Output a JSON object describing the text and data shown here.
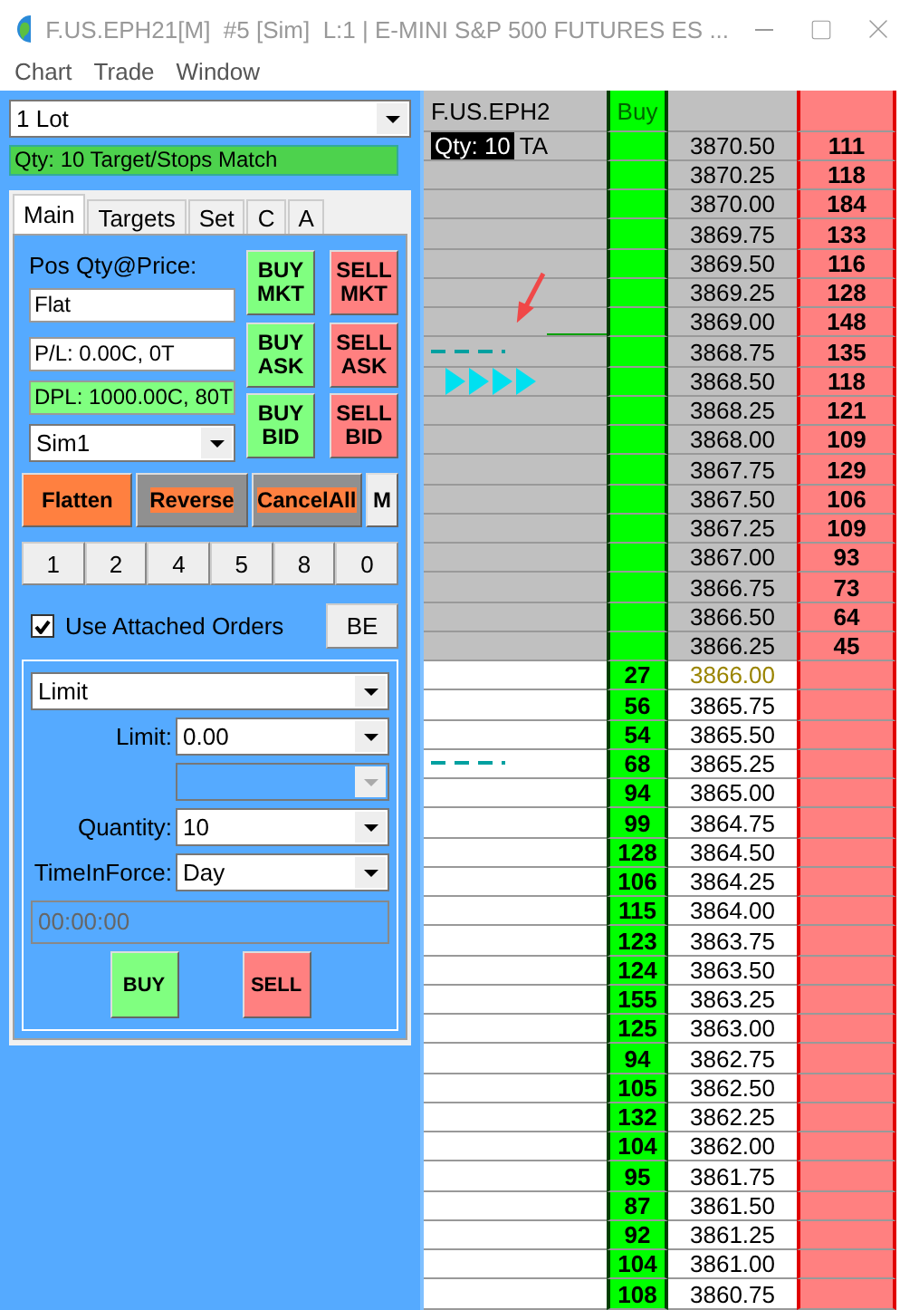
{
  "window": {
    "title": "F.US.EPH21[M]  #5 [Sim]  L:1 | E-MINI S&P 500 FUTURES ES ..."
  },
  "menu": [
    "Chart",
    "Trade",
    "Window"
  ],
  "lot_select": {
    "value": "1 Lot"
  },
  "status_banner": "Qty: 10 Target/Stops Match",
  "tabs": [
    {
      "label": "Main",
      "selected": true
    },
    {
      "label": "Targets",
      "selected": false
    },
    {
      "label": "Set",
      "selected": false
    },
    {
      "label": "C",
      "selected": false
    },
    {
      "label": "A",
      "selected": false
    }
  ],
  "position": {
    "label": "Pos Qty@Price:",
    "value": "Flat"
  },
  "pl_field": {
    "value": "P/L: 0.00C, 0T"
  },
  "dpl_field": {
    "value": "DPL: 1000.00C, 80T"
  },
  "account_select": {
    "value": "Sim1"
  },
  "quick_buttons": [
    {
      "label": "BUY MKT",
      "kind": "buy"
    },
    {
      "label": "SELL MKT",
      "kind": "sell"
    },
    {
      "label": "BUY ASK",
      "kind": "buy"
    },
    {
      "label": "SELL ASK",
      "kind": "sell"
    },
    {
      "label": "BUY BID",
      "kind": "buy"
    },
    {
      "label": "SELL BID",
      "kind": "sell"
    }
  ],
  "action_buttons": [
    {
      "label": "Flatten",
      "kind": "flatten"
    },
    {
      "label": "Reverse",
      "kind": "reverse"
    },
    {
      "label": "CancelAll",
      "kind": "cancel"
    },
    {
      "label": "M",
      "kind": "plain"
    }
  ],
  "qty_presets": [
    "1",
    "2",
    "4",
    "5",
    "8",
    "0"
  ],
  "use_attached_orders": {
    "label": "Use Attached Orders",
    "checked": true
  },
  "be_button": "BE",
  "order": {
    "type": "Limit",
    "fields": [
      {
        "label": "Limit:",
        "value": "0.00",
        "disabled": false
      },
      {
        "disabled": true
      },
      {
        "label": "Quantity:",
        "value": "10",
        "disabled": false
      },
      {
        "label": "TimeInForce:",
        "value": "Day",
        "disabled": false
      }
    ],
    "time_value": "00:00:00",
    "buy_label": "BUY",
    "sell_label": "SELL"
  },
  "ladder": {
    "symbol": "F.US.EPH2",
    "buy_header": "Buy",
    "qty_badge": "Qty: 10",
    "qty_suffix": "TA",
    "rows": [
      {
        "price": "3870.50",
        "ask": "111",
        "kind": "ask",
        "last": false
      },
      {
        "price": "3870.25",
        "ask": "118",
        "kind": "ask",
        "last": false
      },
      {
        "price": "3870.00",
        "ask": "184",
        "kind": "ask",
        "last": false
      },
      {
        "price": "3869.75",
        "ask": "133",
        "kind": "ask",
        "last": false
      },
      {
        "price": "3869.50",
        "ask": "116",
        "kind": "ask",
        "last": false
      },
      {
        "price": "3869.25",
        "ask": "128",
        "kind": "ask",
        "last": false
      },
      {
        "price": "3869.00",
        "ask": "148",
        "kind": "ask",
        "last": false,
        "marker": {
          "kind": "arrow_line"
        }
      },
      {
        "price": "3868.75",
        "ask": "135",
        "kind": "ask",
        "last": false,
        "marker": {
          "kind": "dashes"
        }
      },
      {
        "price": "3868.50",
        "ask": "118",
        "kind": "ask",
        "last": false,
        "marker": {
          "kind": "triangles"
        }
      },
      {
        "price": "3868.25",
        "ask": "121",
        "kind": "ask",
        "last": false
      },
      {
        "price": "3868.00",
        "ask": "109",
        "kind": "ask",
        "last": false
      },
      {
        "price": "3867.75",
        "ask": "129",
        "kind": "ask",
        "last": false
      },
      {
        "price": "3867.50",
        "ask": "106",
        "kind": "ask",
        "last": false
      },
      {
        "price": "3867.25",
        "ask": "109",
        "kind": "ask",
        "last": false
      },
      {
        "price": "3867.00",
        "ask": "93",
        "kind": "ask",
        "last": false
      },
      {
        "price": "3866.75",
        "ask": "73",
        "kind": "ask",
        "last": false
      },
      {
        "price": "3866.50",
        "ask": "64",
        "kind": "ask",
        "last": false
      },
      {
        "price": "3866.25",
        "ask": "45",
        "kind": "ask",
        "last": false
      },
      {
        "price": "3866.00",
        "bid": "27",
        "kind": "bid",
        "last": true
      },
      {
        "price": "3865.75",
        "bid": "56",
        "kind": "bid",
        "last": false
      },
      {
        "price": "3865.50",
        "bid": "54",
        "kind": "bid",
        "last": false
      },
      {
        "price": "3865.25",
        "bid": "68",
        "kind": "bid",
        "last": false,
        "marker": {
          "kind": "dashes"
        }
      },
      {
        "price": "3865.00",
        "bid": "94",
        "kind": "bid",
        "last": false
      },
      {
        "price": "3864.75",
        "bid": "99",
        "kind": "bid",
        "last": false
      },
      {
        "price": "3864.50",
        "bid": "128",
        "kind": "bid",
        "last": false
      },
      {
        "price": "3864.25",
        "bid": "106",
        "kind": "bid",
        "last": false
      },
      {
        "price": "3864.00",
        "bid": "115",
        "kind": "bid",
        "last": false
      },
      {
        "price": "3863.75",
        "bid": "123",
        "kind": "bid",
        "last": false
      },
      {
        "price": "3863.50",
        "bid": "124",
        "kind": "bid",
        "last": false
      },
      {
        "price": "3863.25",
        "bid": "155",
        "kind": "bid",
        "last": false
      },
      {
        "price": "3863.00",
        "bid": "125",
        "kind": "bid",
        "last": false
      },
      {
        "price": "3862.75",
        "bid": "94",
        "kind": "bid",
        "last": false
      },
      {
        "price": "3862.50",
        "bid": "105",
        "kind": "bid",
        "last": false
      },
      {
        "price": "3862.25",
        "bid": "132",
        "kind": "bid",
        "last": false
      },
      {
        "price": "3862.00",
        "bid": "104",
        "kind": "bid",
        "last": false
      },
      {
        "price": "3861.75",
        "bid": "95",
        "kind": "bid",
        "last": false
      },
      {
        "price": "3861.50",
        "bid": "87",
        "kind": "bid",
        "last": false
      },
      {
        "price": "3861.25",
        "bid": "92",
        "kind": "bid",
        "last": false
      },
      {
        "price": "3861.00",
        "bid": "104",
        "kind": "bid",
        "last": false
      },
      {
        "price": "3860.75",
        "bid": "108",
        "kind": "bid",
        "last": false
      }
    ]
  }
}
